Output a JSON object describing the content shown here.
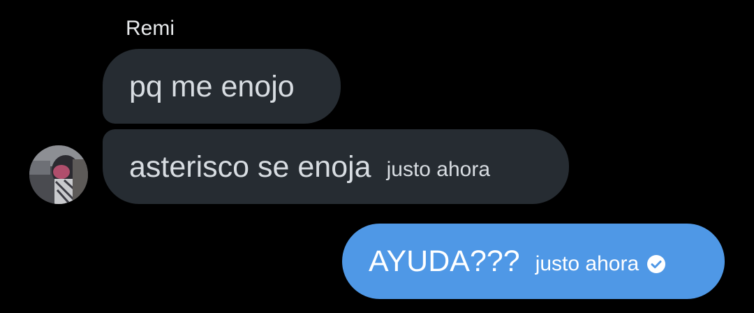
{
  "conversation": {
    "sender_name": "Remi",
    "messages": [
      {
        "direction": "incoming",
        "text": "pq me enojo",
        "time": ""
      },
      {
        "direction": "incoming",
        "text": "asterisco se enoja",
        "time": "justo ahora"
      },
      {
        "direction": "outgoing",
        "text": "AYUDA???",
        "time": "justo ahora",
        "status_icon": "read-check-icon"
      }
    ]
  },
  "colors": {
    "background": "#000000",
    "incoming_bubble": "#262c32",
    "outgoing_bubble": "#4f98e6",
    "incoming_text": "#d8dde2",
    "outgoing_text": "#ffffff"
  },
  "avatar": {
    "icon": "user-avatar"
  }
}
